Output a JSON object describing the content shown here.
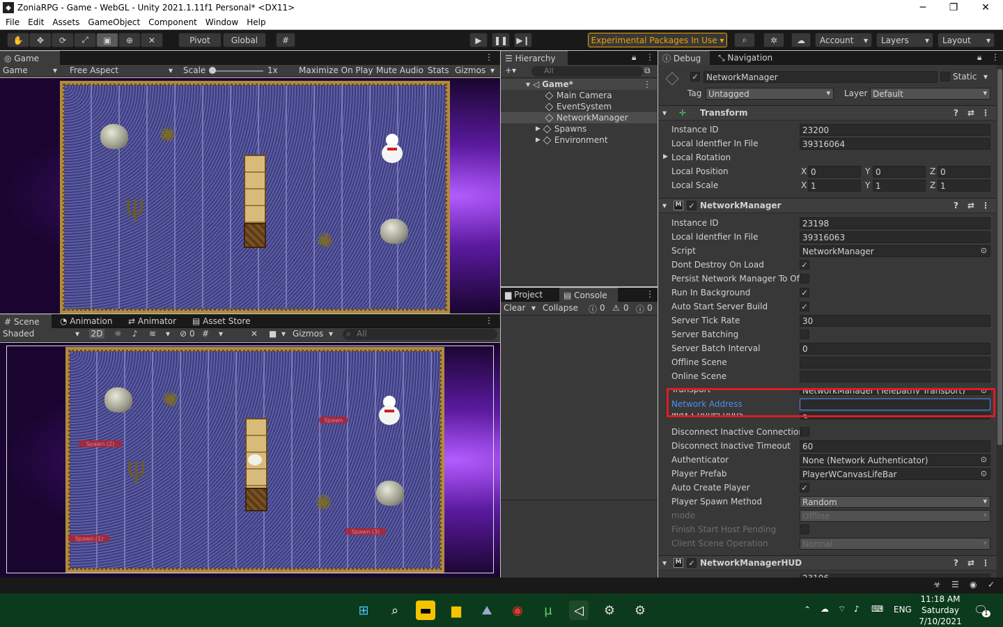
{
  "window": {
    "title": "ZoniaRPG - Game - WebGL - Unity 2021.1.11f1 Personal* <DX11>",
    "minimize": "─",
    "maximize": "❐",
    "close": "✕"
  },
  "menu": [
    "File",
    "Edit",
    "Assets",
    "GameObject",
    "Component",
    "Window",
    "Help"
  ],
  "toolbar": {
    "pivot": "Pivot",
    "global": "Global",
    "experimental": "Experimental Packages In Use",
    "account": "Account",
    "layers": "Layers",
    "layout": "Layout"
  },
  "game_panel": {
    "tab": "Game",
    "display": "Game",
    "aspect": "Free Aspect",
    "scale_label": "Scale",
    "scale_value": "1x",
    "maximize": "Maximize On Play",
    "mute": "Mute Audio",
    "stats": "Stats",
    "gizmos": "Gizmos"
  },
  "scene_panel": {
    "tabs": [
      "Scene",
      "Animation",
      "Animator",
      "Asset Store"
    ],
    "shading": "Shaded",
    "mode2d": "2D",
    "hidden_count": "0",
    "gizmos": "Gizmos",
    "search_placeholder": "All",
    "spawns": [
      "Spawn",
      "Spawn (2)",
      "Spawn (1)",
      "Spawn (3)"
    ]
  },
  "hierarchy": {
    "tab": "Hierarchy",
    "search_placeholder": "All",
    "scene": "Game*",
    "items": [
      "Main Camera",
      "EventSystem",
      "NetworkManager",
      "Spawns",
      "Environment"
    ]
  },
  "console": {
    "tabs": [
      "Project",
      "Console"
    ],
    "clear": "Clear",
    "collapse": "Collapse",
    "info_count": "0",
    "warn_count": "0",
    "error_count": "0"
  },
  "inspector": {
    "tabs": [
      "Debug",
      "Navigation"
    ],
    "object_name": "NetworkManager",
    "static_label": "Static",
    "tag_label": "Tag",
    "tag_value": "Untagged",
    "layer_label": "Layer",
    "layer_value": "Default",
    "transform": {
      "title": "Transform",
      "instance_id_label": "Instance ID",
      "instance_id": "23200",
      "local_id_label": "Local Identfier In File",
      "local_id": "39316064",
      "rotation_label": "Local Rotation",
      "position_label": "Local Position",
      "pos": [
        "0",
        "0",
        "0"
      ],
      "scale_label": "Local Scale",
      "scale": [
        "1",
        "1",
        "1"
      ],
      "axes": [
        "X",
        "Y",
        "Z"
      ]
    },
    "network_manager": {
      "title": "NetworkManager",
      "rows": [
        {
          "label": "Instance ID",
          "value": "23198",
          "kind": "field"
        },
        {
          "label": "Local Identfier In File",
          "value": "39316063",
          "kind": "field"
        },
        {
          "label": "Script",
          "value": "NetworkManager",
          "kind": "object"
        },
        {
          "label": "Dont Destroy On Load",
          "value": "✓",
          "kind": "check"
        },
        {
          "label": "Persist Network Manager To Offl",
          "value": "",
          "kind": "check"
        },
        {
          "label": "Run In Background",
          "value": "✓",
          "kind": "check"
        },
        {
          "label": "Auto Start Server Build",
          "value": "✓",
          "kind": "check"
        },
        {
          "label": "Server Tick Rate",
          "value": "30",
          "kind": "field"
        },
        {
          "label": "Server Batching",
          "value": "",
          "kind": "check"
        },
        {
          "label": "Server Batch Interval",
          "value": "0",
          "kind": "field"
        },
        {
          "label": "Offline Scene",
          "value": "",
          "kind": "field"
        },
        {
          "label": "Online Scene",
          "value": "",
          "kind": "field"
        },
        {
          "label": "Transport",
          "value": "NetworkManager (Telepathy Transport)",
          "kind": "object"
        },
        {
          "label": "Network Address",
          "value": "",
          "kind": "field"
        },
        {
          "label": "Max Connections",
          "value": "3",
          "kind": "field"
        },
        {
          "label": "Disconnect Inactive Connection:",
          "value": "",
          "kind": "check"
        },
        {
          "label": "Disconnect Inactive Timeout",
          "value": "60",
          "kind": "field"
        },
        {
          "label": "Authenticator",
          "value": "None (Network Authenticator)",
          "kind": "object"
        },
        {
          "label": "Player Prefab",
          "value": "PlayerWCanvasLifeBar",
          "kind": "object"
        },
        {
          "label": "Auto Create Player",
          "value": "✓",
          "kind": "check"
        },
        {
          "label": "Player Spawn Method",
          "value": "Random",
          "kind": "dropdown"
        },
        {
          "label": "mode",
          "value": "Offline",
          "kind": "dropdown-dim"
        },
        {
          "label": "Finish Start Host Pending",
          "value": "",
          "kind": "check-dim"
        },
        {
          "label": "Client Scene Operation",
          "value": "Normal",
          "kind": "dropdown-dim"
        }
      ]
    },
    "hud_title": "NetworkManagerHUD",
    "partial_value": "23196"
  },
  "taskbar": {
    "lang": "ENG",
    "time": "11:18 AM",
    "day": "Saturday",
    "date": "7/10/2021",
    "notif_count": "1"
  },
  "colors": {
    "highlight": "#e01b24",
    "selected_label": "#4d8ee8",
    "accent_exp": "#f0a000"
  }
}
